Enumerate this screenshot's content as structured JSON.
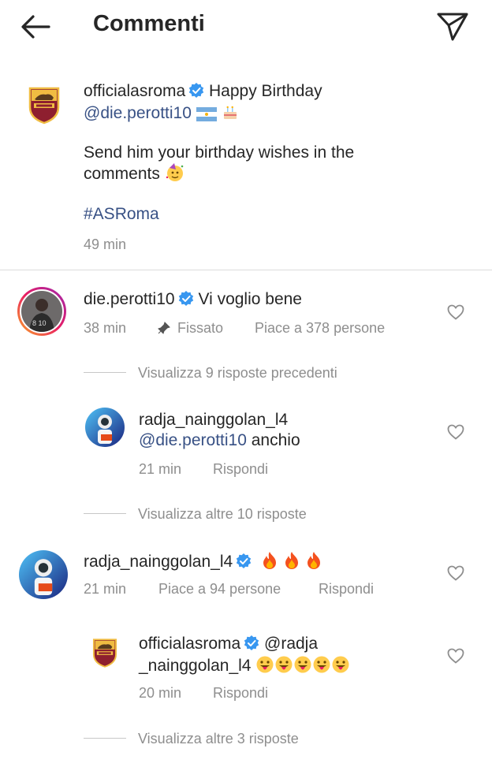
{
  "header": {
    "title": "Commenti",
    "back_icon": "arrow-left-icon",
    "send_icon": "paper-plane-icon"
  },
  "caption": {
    "username": "officialasroma",
    "line1_text": "Happy Birthday",
    "mention": "@die.perotti10",
    "line2": "Send him your birthday wishes in the",
    "line3": "comments",
    "hashtag": "#ASRoma",
    "time": "49 min"
  },
  "comments": [
    {
      "username": "die.perotti10",
      "text": "Vi voglio bene",
      "time": "38 min",
      "pinned": "Fissato",
      "likes": "Piace a 378 persone",
      "view_previous": "Visualizza 9 risposte precedenti",
      "reply": {
        "username": "radja_nainggolan_l4",
        "mention": "@die.perotti10",
        "text": "anchio",
        "time": "21 min",
        "reply_label": "Rispondi"
      },
      "view_more": "Visualizza altre 10 risposte"
    },
    {
      "username": "radja_nainggolan_l4",
      "time": "21 min",
      "likes": "Piace a 94 persone",
      "reply_label": "Rispondi",
      "reply": {
        "username": "officialasroma",
        "mention_part1": "@radja",
        "mention_part2": "_nainggolan_l4",
        "time": "20 min",
        "reply_label": "Rispondi"
      },
      "view_more": "Visualizza altre 3 risposte"
    }
  ],
  "colors": {
    "text": "#262626",
    "secondary": "#8e8e8e",
    "link": "#385185",
    "verified": "#3897f0",
    "roma_red": "#8e1f2f",
    "roma_gold": "#f0bc42"
  }
}
